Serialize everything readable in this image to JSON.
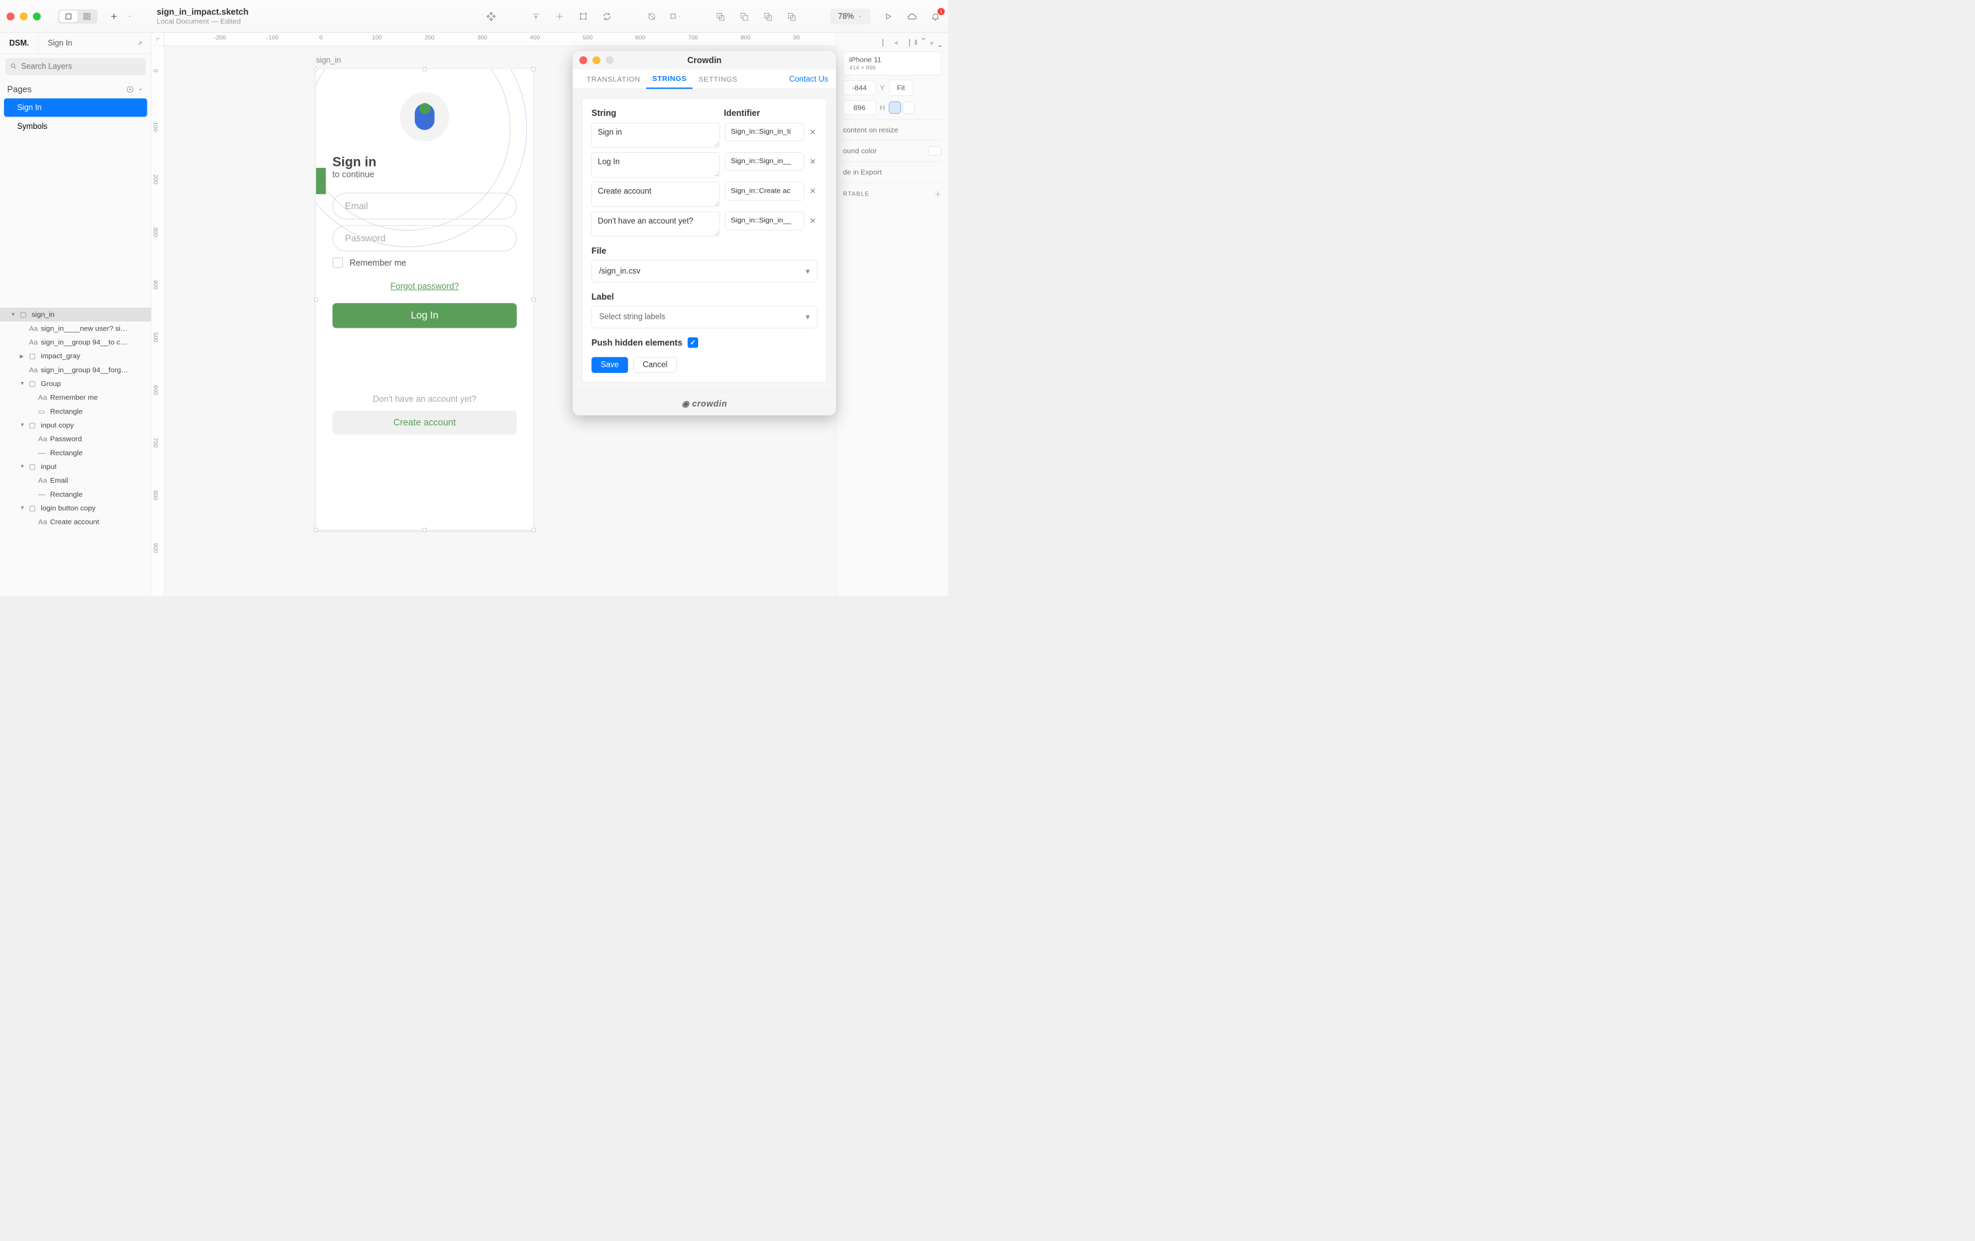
{
  "titlebar": {
    "doc_name": "sign_in_impact.sketch",
    "doc_status": "Local Document — Edited",
    "zoom": "78%",
    "notification_count": "1"
  },
  "sidebar": {
    "tab_dsm": "DSM.",
    "tab_name": "Sign In",
    "search_placeholder": "Search Layers",
    "pages_header": "Pages",
    "pages": [
      {
        "label": "Sign In",
        "selected": true
      },
      {
        "label": "Symbols",
        "selected": false
      }
    ],
    "layers": [
      {
        "indent": 0,
        "icon": "artboard",
        "label": "sign_in",
        "caret": "▼",
        "selected": true
      },
      {
        "indent": 1,
        "icon": "text",
        "label": "sign_in____new user? si…",
        "caret": ""
      },
      {
        "indent": 1,
        "icon": "text",
        "label": "sign_in__group 94__to c…",
        "caret": ""
      },
      {
        "indent": 1,
        "icon": "folder",
        "label": "impact_gray",
        "caret": "▶"
      },
      {
        "indent": 1,
        "icon": "text",
        "label": "sign_in__group 94__forg…",
        "caret": ""
      },
      {
        "indent": 1,
        "icon": "folder",
        "label": "Group",
        "caret": "▼"
      },
      {
        "indent": 2,
        "icon": "text",
        "label": "Remember me",
        "caret": ""
      },
      {
        "indent": 2,
        "icon": "rect",
        "label": "Rectangle",
        "caret": ""
      },
      {
        "indent": 1,
        "icon": "folder",
        "label": "input copy",
        "caret": "▼"
      },
      {
        "indent": 2,
        "icon": "text",
        "label": "Password",
        "caret": ""
      },
      {
        "indent": 2,
        "icon": "line",
        "label": "Rectangle",
        "caret": ""
      },
      {
        "indent": 1,
        "icon": "folder",
        "label": "input",
        "caret": "▼"
      },
      {
        "indent": 2,
        "icon": "text",
        "label": "Email",
        "caret": ""
      },
      {
        "indent": 2,
        "icon": "line",
        "label": "Rectangle",
        "caret": ""
      },
      {
        "indent": 1,
        "icon": "folder",
        "label": "login button copy",
        "caret": "▼"
      },
      {
        "indent": 2,
        "icon": "text",
        "label": "Create account",
        "caret": ""
      }
    ]
  },
  "ruler": {
    "h": [
      "-200",
      "-100",
      "0",
      "100",
      "200",
      "300",
      "400",
      "500",
      "600",
      "700",
      "800",
      "90"
    ],
    "v": [
      "0",
      "100",
      "200",
      "300",
      "400",
      "500",
      "600",
      "700",
      "800",
      "900"
    ]
  },
  "artboard": {
    "name": "sign_in",
    "h1": "Sign in",
    "h2": "to continue",
    "email_placeholder": "Email",
    "password_placeholder": "Password",
    "remember": "Remember me",
    "forgot": "Forgot password?",
    "login_btn": "Log In",
    "no_account": "Don't have an account yet?",
    "create_btn": "Create account"
  },
  "inspector": {
    "device_name": "iPhone 11",
    "device_size": "414 × 896",
    "x_value": "-844",
    "y_label": "Y",
    "fit": "Fit",
    "w_value": "896",
    "h_label": "H",
    "resize_content": "content on resize",
    "bg_color": "ound color",
    "include_export": "de in Export",
    "exportable": "RTABLE"
  },
  "panel": {
    "title": "Crowdin",
    "tabs": {
      "translation": "TRANSLATION",
      "strings": "STRINGS",
      "settings": "SETTINGS"
    },
    "contact": "Contact Us",
    "string_header": "String",
    "identifier_header": "Identifier",
    "rows": [
      {
        "string": "Sign in",
        "identifier": "Sign_in::Sign_in_ti"
      },
      {
        "string": "Log In",
        "identifier": "Sign_in::Sign_in__"
      },
      {
        "string": "Create account",
        "identifier": "Sign_in::Create ac"
      },
      {
        "string": "Don't have an account yet?",
        "identifier": "Sign_in::Sign_in__"
      }
    ],
    "file_header": "File",
    "file_value": "/sign_in.csv",
    "label_header": "Label",
    "label_placeholder": "Select string labels",
    "push_label": "Push hidden elements",
    "save": "Save",
    "cancel": "Cancel",
    "footer_brand": "crowdin"
  }
}
